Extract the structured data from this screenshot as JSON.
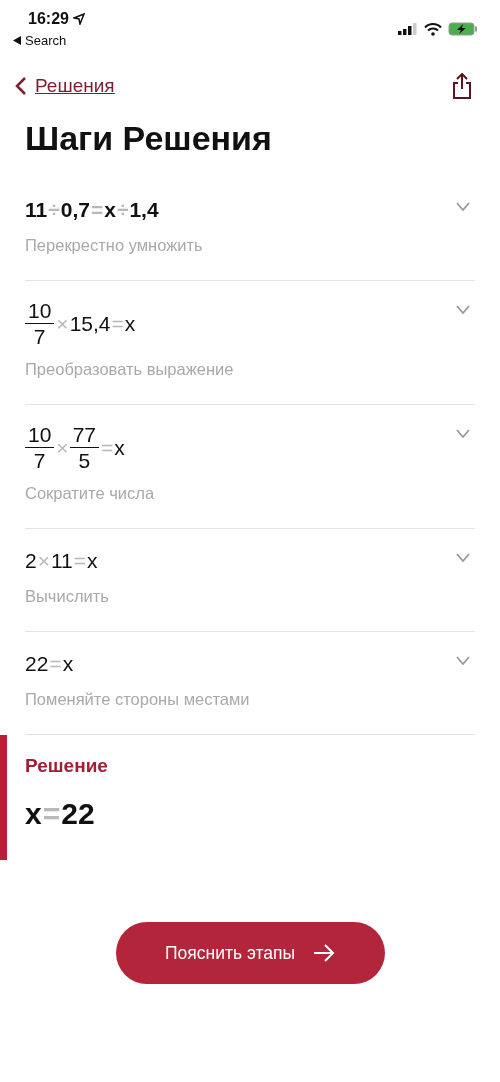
{
  "status_bar": {
    "time": "16:29",
    "back_app": "Search"
  },
  "nav": {
    "back_label": "Решения"
  },
  "title": "Шаги Решения",
  "steps": [
    {
      "emphasized": true,
      "expanded": false,
      "caption": "Перекрестно умножить",
      "expr": [
        {
          "kind": "num",
          "text": "11"
        },
        {
          "kind": "op",
          "text": "÷"
        },
        {
          "kind": "num",
          "text": "0,7"
        },
        {
          "kind": "op",
          "text": "="
        },
        {
          "kind": "num",
          "text": "x"
        },
        {
          "kind": "op",
          "text": "÷"
        },
        {
          "kind": "num",
          "text": "1,4"
        }
      ]
    },
    {
      "emphasized": false,
      "expanded": false,
      "caption": "Преобразовать выражение",
      "expr": [
        {
          "kind": "frac",
          "num": "10",
          "den": "7"
        },
        {
          "kind": "op",
          "text": "×"
        },
        {
          "kind": "num",
          "text": "15,4"
        },
        {
          "kind": "op",
          "text": "="
        },
        {
          "kind": "num",
          "text": "x"
        }
      ]
    },
    {
      "emphasized": false,
      "expanded": false,
      "caption": "Сократите числа",
      "expr": [
        {
          "kind": "frac",
          "num": "10",
          "den": "7"
        },
        {
          "kind": "op",
          "text": "×"
        },
        {
          "kind": "frac",
          "num": "77",
          "den": "5"
        },
        {
          "kind": "op",
          "text": "="
        },
        {
          "kind": "num",
          "text": "x"
        }
      ]
    },
    {
      "emphasized": false,
      "expanded": false,
      "caption": "Вычислить",
      "expr": [
        {
          "kind": "num",
          "text": "2"
        },
        {
          "kind": "op",
          "text": "×"
        },
        {
          "kind": "num",
          "text": "11"
        },
        {
          "kind": "op",
          "text": "="
        },
        {
          "kind": "num",
          "text": "x"
        }
      ]
    },
    {
      "emphasized": false,
      "expanded": false,
      "caption": "Поменяйте стороны местами",
      "expr": [
        {
          "kind": "num",
          "text": "22"
        },
        {
          "kind": "op",
          "text": "="
        },
        {
          "kind": "num",
          "text": "x"
        }
      ]
    }
  ],
  "solution": {
    "label": "Решение",
    "expr": [
      {
        "kind": "num",
        "text": "x"
      },
      {
        "kind": "op",
        "text": "="
      },
      {
        "kind": "num",
        "text": "22"
      }
    ]
  },
  "explain_button": {
    "label": "Пояснить этапы"
  }
}
